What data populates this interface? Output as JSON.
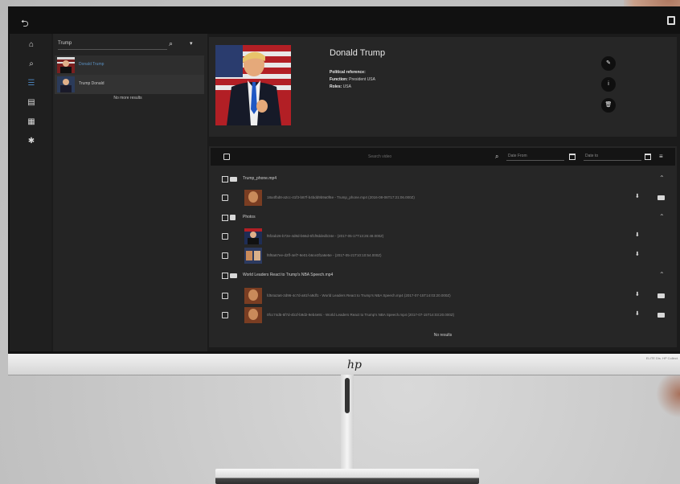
{
  "app": {
    "topbar": {
      "back_icon": "back-arrow-icon",
      "account_icon": "account-icon"
    },
    "rail": {
      "icons": [
        "home-icon",
        "search-icon",
        "people-icon",
        "document-icon",
        "grid-icon",
        "settings-icon"
      ]
    },
    "search_panel": {
      "query": "Trump",
      "results": [
        {
          "label": "Donald Trump"
        },
        {
          "label": "Trump Donald"
        }
      ],
      "footer": "No more results"
    },
    "person": {
      "name": "Donald Trump",
      "fields": [
        {
          "key": "Political reference:",
          "value": ""
        },
        {
          "key": "Function:",
          "value": "President USA"
        },
        {
          "key": "Roles:",
          "value": "USA"
        }
      ],
      "actions": [
        "edit-icon",
        "info-icon",
        "delete-icon"
      ]
    },
    "list": {
      "search_placeholder": "Search video",
      "date_from": "Date From",
      "date_to": "Date to",
      "groups": [
        {
          "name": "Trump_phone.mp4",
          "kind": "video",
          "items": [
            {
              "text": "18a4fbd8-a2cc-41f3-b87f-b4bdd9b9a0f6e - Trump_phone.mp4 (2016-08-06T17:21:06.000Z)",
              "has_actions": true
            }
          ]
        },
        {
          "name": "Photos",
          "kind": "photo",
          "items": [
            {
              "text": "f6f2ab26-b72e-4d8d-b66d-6f1f9ddedb34e - (2017-05-17T13:26:48.000Z)",
              "has_actions": false
            },
            {
              "text": "f6f8a67ee-d2ff-4ef7-9e01-b6ce3f1a6e5e - (2017-05-21T10:10:54.000Z)",
              "has_actions": false
            }
          ]
        },
        {
          "name": "World Leaders React to Trump's NBA Speech.mp4",
          "kind": "video",
          "items": [
            {
              "text": "fd54a2a6-2d96-4c7d-a81f-a9df1 - World Leaders React to Trump's NBA Speech.mp4 (2017-07-15T14:03:20.000Z)",
              "has_actions": true
            },
            {
              "text": "0fcc74d5-5f7d-4b1f-b9d2-9eb4e8c - World Leaders React to Trump's NBA Speech.mp4 (2017-07-15T14:03:20.000Z)",
              "has_actions": true
            }
          ]
        }
      ],
      "footer": "No results"
    },
    "monitor": {
      "brand_icon": "hp-logo-icon",
      "chin_text": "ELITE Dis. HP Collect."
    }
  }
}
